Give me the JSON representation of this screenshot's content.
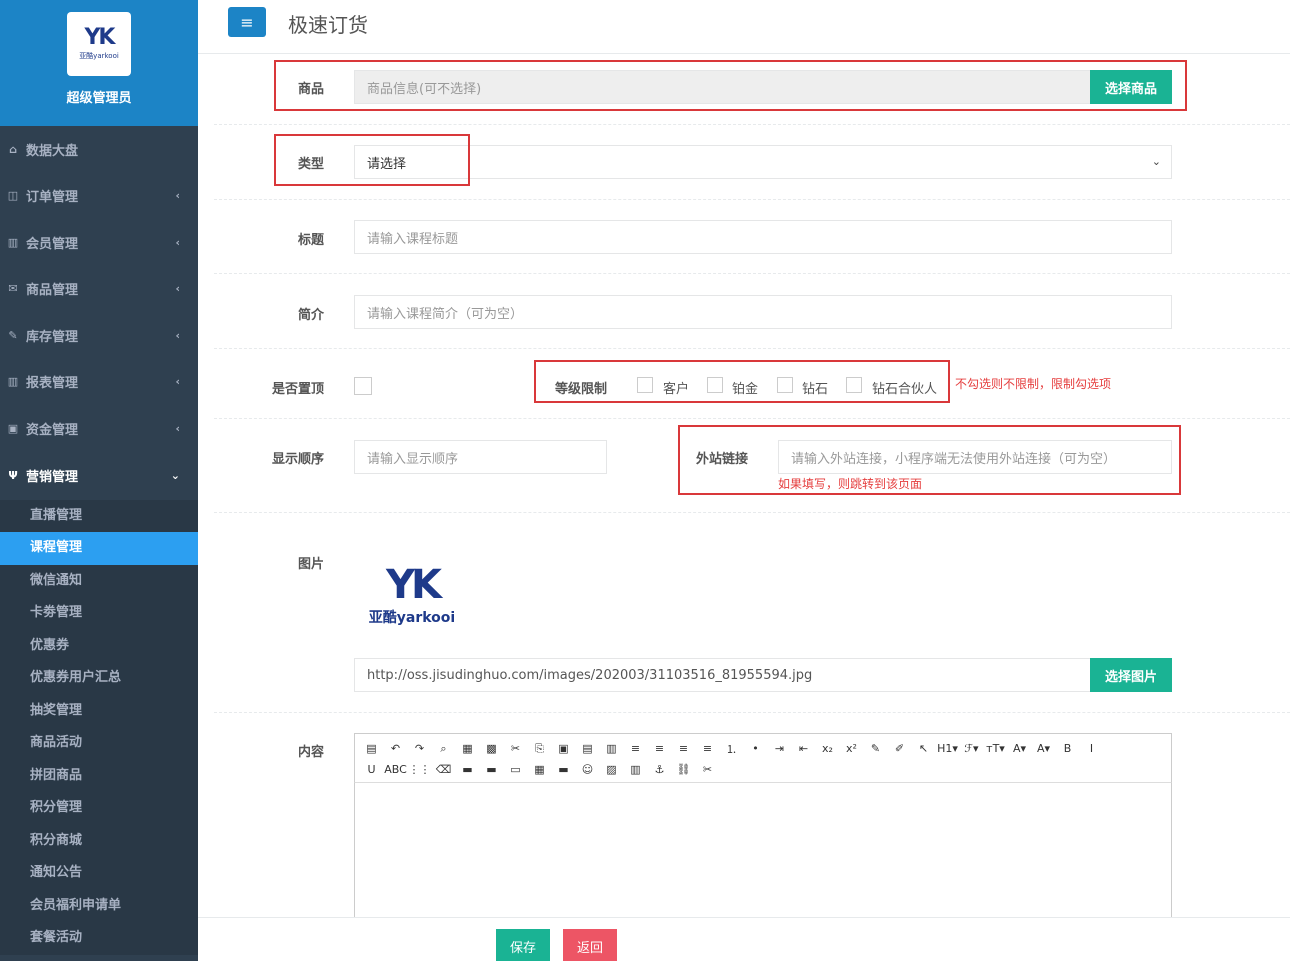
{
  "sidebar": {
    "logo_mark": "YK",
    "logo_sub": "亚酷yarkooi",
    "admin_name": "超级管理员",
    "items": [
      {
        "label": "数据大盘",
        "icon": "⌂"
      },
      {
        "label": "订单管理",
        "icon": "◫"
      },
      {
        "label": "会员管理",
        "icon": "▥"
      },
      {
        "label": "商品管理",
        "icon": "✉"
      },
      {
        "label": "库存管理",
        "icon": "✎"
      },
      {
        "label": "报表管理",
        "icon": "▥"
      },
      {
        "label": "资金管理",
        "icon": "▣"
      }
    ],
    "open_item": {
      "label": "营销管理",
      "icon": "Ψ"
    },
    "sub_items": [
      "直播管理",
      "课程管理",
      "微信通知",
      "卡劵管理",
      "优惠券",
      "优惠券用户汇总",
      "抽奖管理",
      "商品活动",
      "拼团商品",
      "积分管理",
      "积分商城",
      "通知公告",
      "会员福利申请单",
      "套餐活动"
    ],
    "chevron_closed": "‹",
    "chevron_open": "⌄"
  },
  "header": {
    "menu_icon": "≡",
    "title": "极速订货"
  },
  "form": {
    "product": {
      "label": "商品",
      "placeholder": "商品信息(可不选择)",
      "button": "选择商品"
    },
    "type": {
      "label": "类型",
      "value": "请选择"
    },
    "title": {
      "label": "标题",
      "placeholder": "请输入课程标题"
    },
    "intro": {
      "label": "简介",
      "placeholder": "请输入课程简介（可为空）"
    },
    "pin": {
      "label": "是否置顶"
    },
    "level": {
      "label": "等级限制",
      "options": [
        "客户",
        "铂金",
        "钻石",
        "钻石合伙人"
      ],
      "hint": "不勾选则不限制，限制勾选项"
    },
    "order": {
      "label": "显示顺序",
      "placeholder": "请输入显示顺序"
    },
    "link": {
      "label": "外站链接",
      "placeholder": "请输入外站连接，小程序端无法使用外站连接（可为空）",
      "hint": "如果填写，则跳转到该页面"
    },
    "image": {
      "label": "图片",
      "url": "http://oss.jisudinghuo.com/images/202003/31103516_81955594.jpg",
      "button": "选择图片",
      "logo_mark": "YK",
      "logo_text": "亚酷yarkooi"
    },
    "content": {
      "label": "内容"
    }
  },
  "toolbar": {
    "row1": [
      "▤",
      "↶",
      "↷",
      "⌕",
      "▦",
      "▩",
      "✂",
      "⎘",
      "▣",
      "▤",
      "▥",
      "≡",
      "≡",
      "≡",
      "≡",
      "⒈",
      "•",
      "⇥",
      "⇤",
      "x₂",
      "x²",
      "✎",
      "✐",
      "↖",
      "H1▾",
      "ℱ▾",
      "тT▾",
      "A▾",
      "A▾",
      "B",
      "I"
    ],
    "row2": [
      "U",
      "ABC",
      "⋮⋮",
      "⌫",
      "▬",
      "▬",
      "▭",
      "▦",
      "▬",
      "☺",
      "▨",
      "▥",
      "⚓",
      "⛓",
      "✂"
    ]
  },
  "footer": {
    "save": "保存",
    "back": "返回"
  },
  "colors": {
    "sidebar": "#2f4050",
    "primary": "#1c84c6",
    "green": "#1ab394",
    "red": "#ed5565",
    "active": "#2c9ff1"
  }
}
